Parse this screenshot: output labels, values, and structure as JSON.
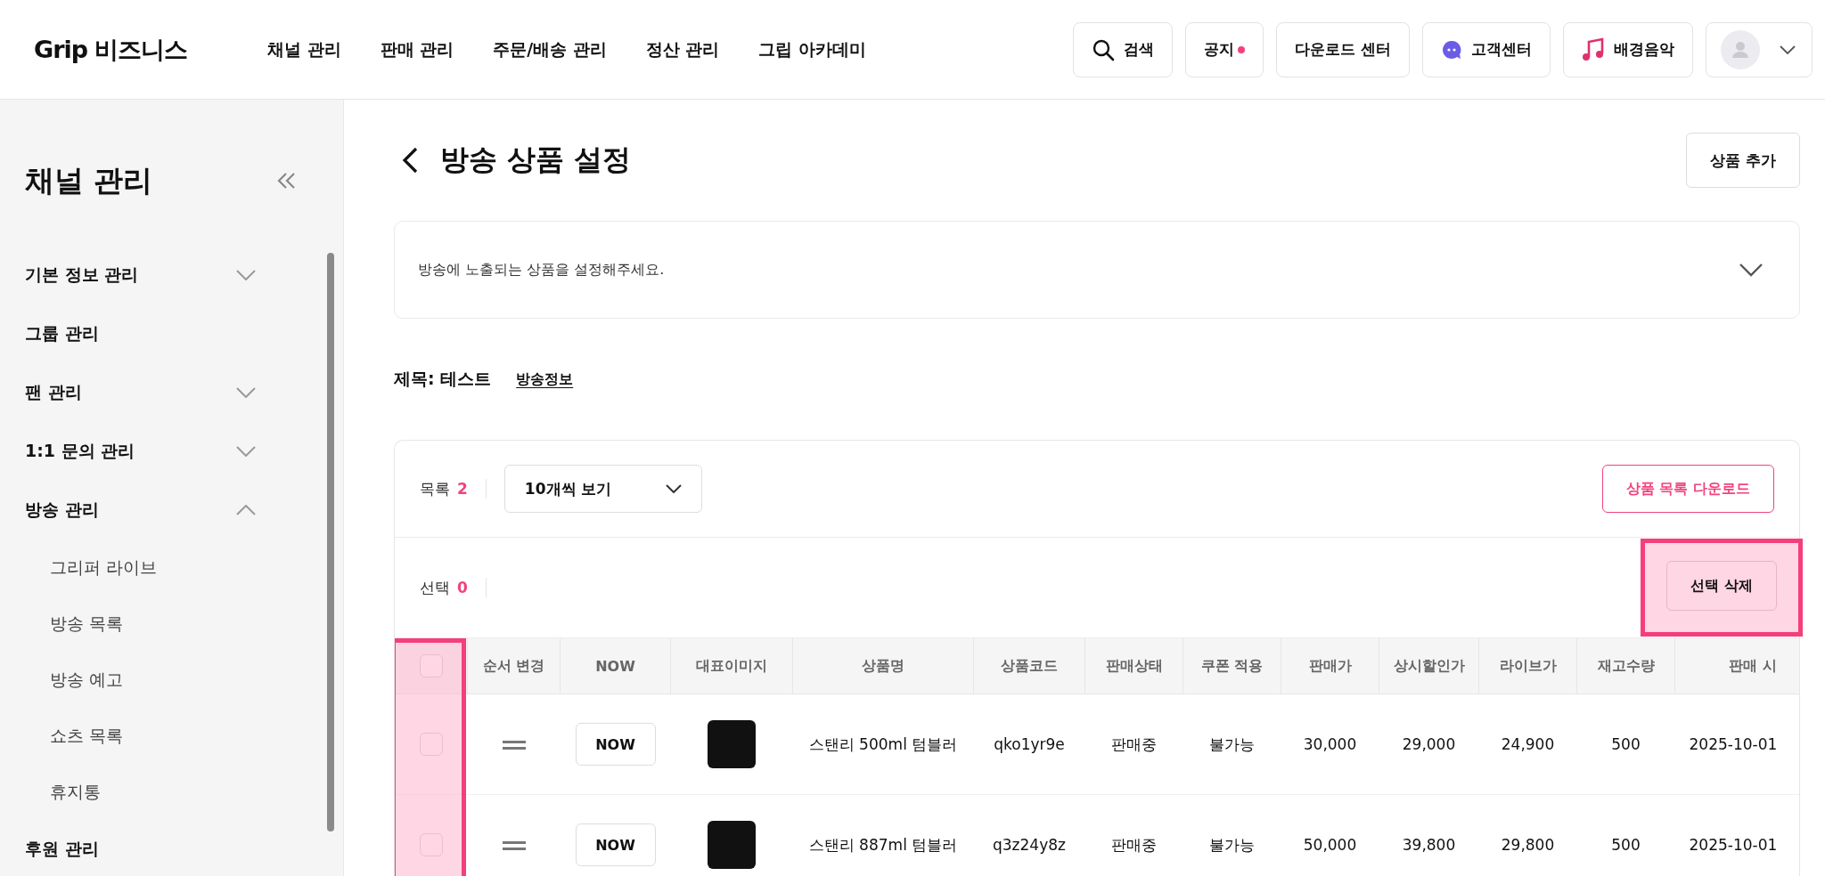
{
  "header": {
    "logo": "Grip 비즈니스",
    "nav": [
      {
        "label": "채널 관리"
      },
      {
        "label": "판매 관리"
      },
      {
        "label": "주문/배송 관리"
      },
      {
        "label": "정산 관리"
      },
      {
        "label": "그립 아카데미"
      }
    ],
    "actions": [
      {
        "kind": "search",
        "label": "검색"
      },
      {
        "kind": "notice",
        "label": "공지",
        "unread": true
      },
      {
        "kind": "plain",
        "label": "다운로드 센터"
      },
      {
        "kind": "chat",
        "label": "고객센터"
      },
      {
        "kind": "music",
        "label": "배경음악"
      }
    ]
  },
  "sidebar": {
    "title": "채널 관리",
    "items": [
      {
        "kind": "group",
        "label": "기본 정보 관리",
        "expanded": false
      },
      {
        "kind": "link",
        "label": "그룹 관리"
      },
      {
        "kind": "group",
        "label": "팬 관리",
        "expanded": false
      },
      {
        "kind": "group",
        "label": "1:1 문의 관리",
        "expanded": false
      },
      {
        "kind": "group",
        "label": "방송 관리",
        "expanded": true,
        "children": [
          {
            "label": "그리퍼 라이브"
          },
          {
            "label": "방송 목록"
          },
          {
            "label": "방송 예고"
          },
          {
            "label": "쇼츠 목록"
          },
          {
            "label": "휴지통"
          }
        ]
      },
      {
        "kind": "link",
        "label": "후원 관리"
      }
    ]
  },
  "page": {
    "title": "방송 상품 설정",
    "add_button": "상품 추가",
    "notice": {
      "text": "방송에 노출되는 상품을 설정해주세요.",
      "expanded": false
    },
    "broadcast": {
      "title": "제목: 테스트",
      "link": "방송정보"
    }
  },
  "toolbar": {
    "list_label": "목록",
    "list_count": "2",
    "page_size": "10개씩 보기",
    "download_button": "상품 목록 다운로드",
    "selection_label": "선택",
    "selection_count": "0",
    "delete_button": {
      "label": "선택 삭제",
      "highlighted": true
    }
  },
  "table": {
    "select_all_checked": false,
    "checkbox_column_highlighted": true,
    "columns": [
      "순서 변경",
      "NOW",
      "대표이미지",
      "상품명",
      "상품코드",
      "판매상태",
      "쿠폰 적용",
      "판매가",
      "상시할인가",
      "라이브가",
      "재고수량",
      "판매 시"
    ],
    "rows": [
      {
        "checked": false,
        "now": "NOW",
        "name": "스탠리 500ml 텀블러",
        "code": "qko1yr9e",
        "status": "판매중",
        "coupon": "불가능",
        "price": "30,000",
        "discount_price": "29,000",
        "live_price": "24,900",
        "stock": "500",
        "start": "2025-10-01"
      },
      {
        "checked": false,
        "now": "NOW",
        "name": "스탠리 887ml 텀블러",
        "code": "q3z24y8z",
        "status": "판매중",
        "coupon": "불가능",
        "price": "50,000",
        "discount_price": "39,800",
        "live_price": "29,800",
        "stock": "500",
        "start": "2025-10-01"
      }
    ]
  }
}
